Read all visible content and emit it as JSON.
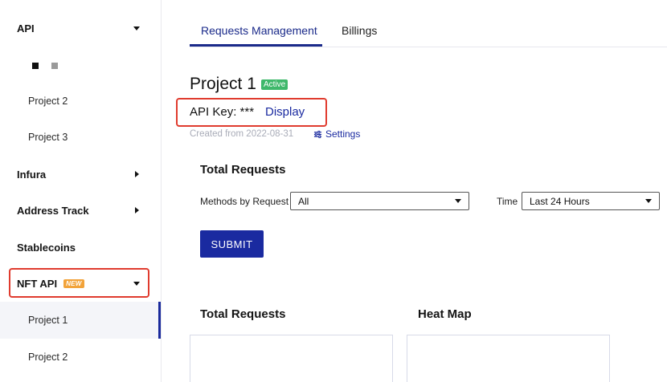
{
  "sidebar": {
    "api_label": "API",
    "project_2_label": "Project 2",
    "project_3_label": "Project 3",
    "infura_label": "Infura",
    "address_track_label": "Address Track",
    "stablecoins_label": "Stablecoins",
    "nft_api_label": "NFT API",
    "nft_new_badge": "NEW",
    "nft_project_1_label": "Project 1",
    "nft_project_2_label": "Project 2"
  },
  "tabs": {
    "requests_management": "Requests Management",
    "billings": "Billings"
  },
  "project": {
    "title": "Project 1",
    "status": "Active",
    "api_key_label": "API Key: ***",
    "display_link": "Display",
    "created": "Created from 2022-08-31",
    "settings_link": "Settings"
  },
  "filters": {
    "heading": "Total Requests",
    "methods_label": "Methods by Request",
    "methods_value": "All",
    "time_label": "Time",
    "time_value": "Last 24 Hours",
    "submit_label": "SUBMIT"
  },
  "panels": {
    "total_requests_heading": "Total Requests",
    "heat_map_heading": "Heat Map"
  },
  "colors": {
    "accent": "#1a2aa0",
    "highlight": "#e03b2e",
    "status_active": "#3fb86b",
    "new_badge": "#f2a33a"
  }
}
